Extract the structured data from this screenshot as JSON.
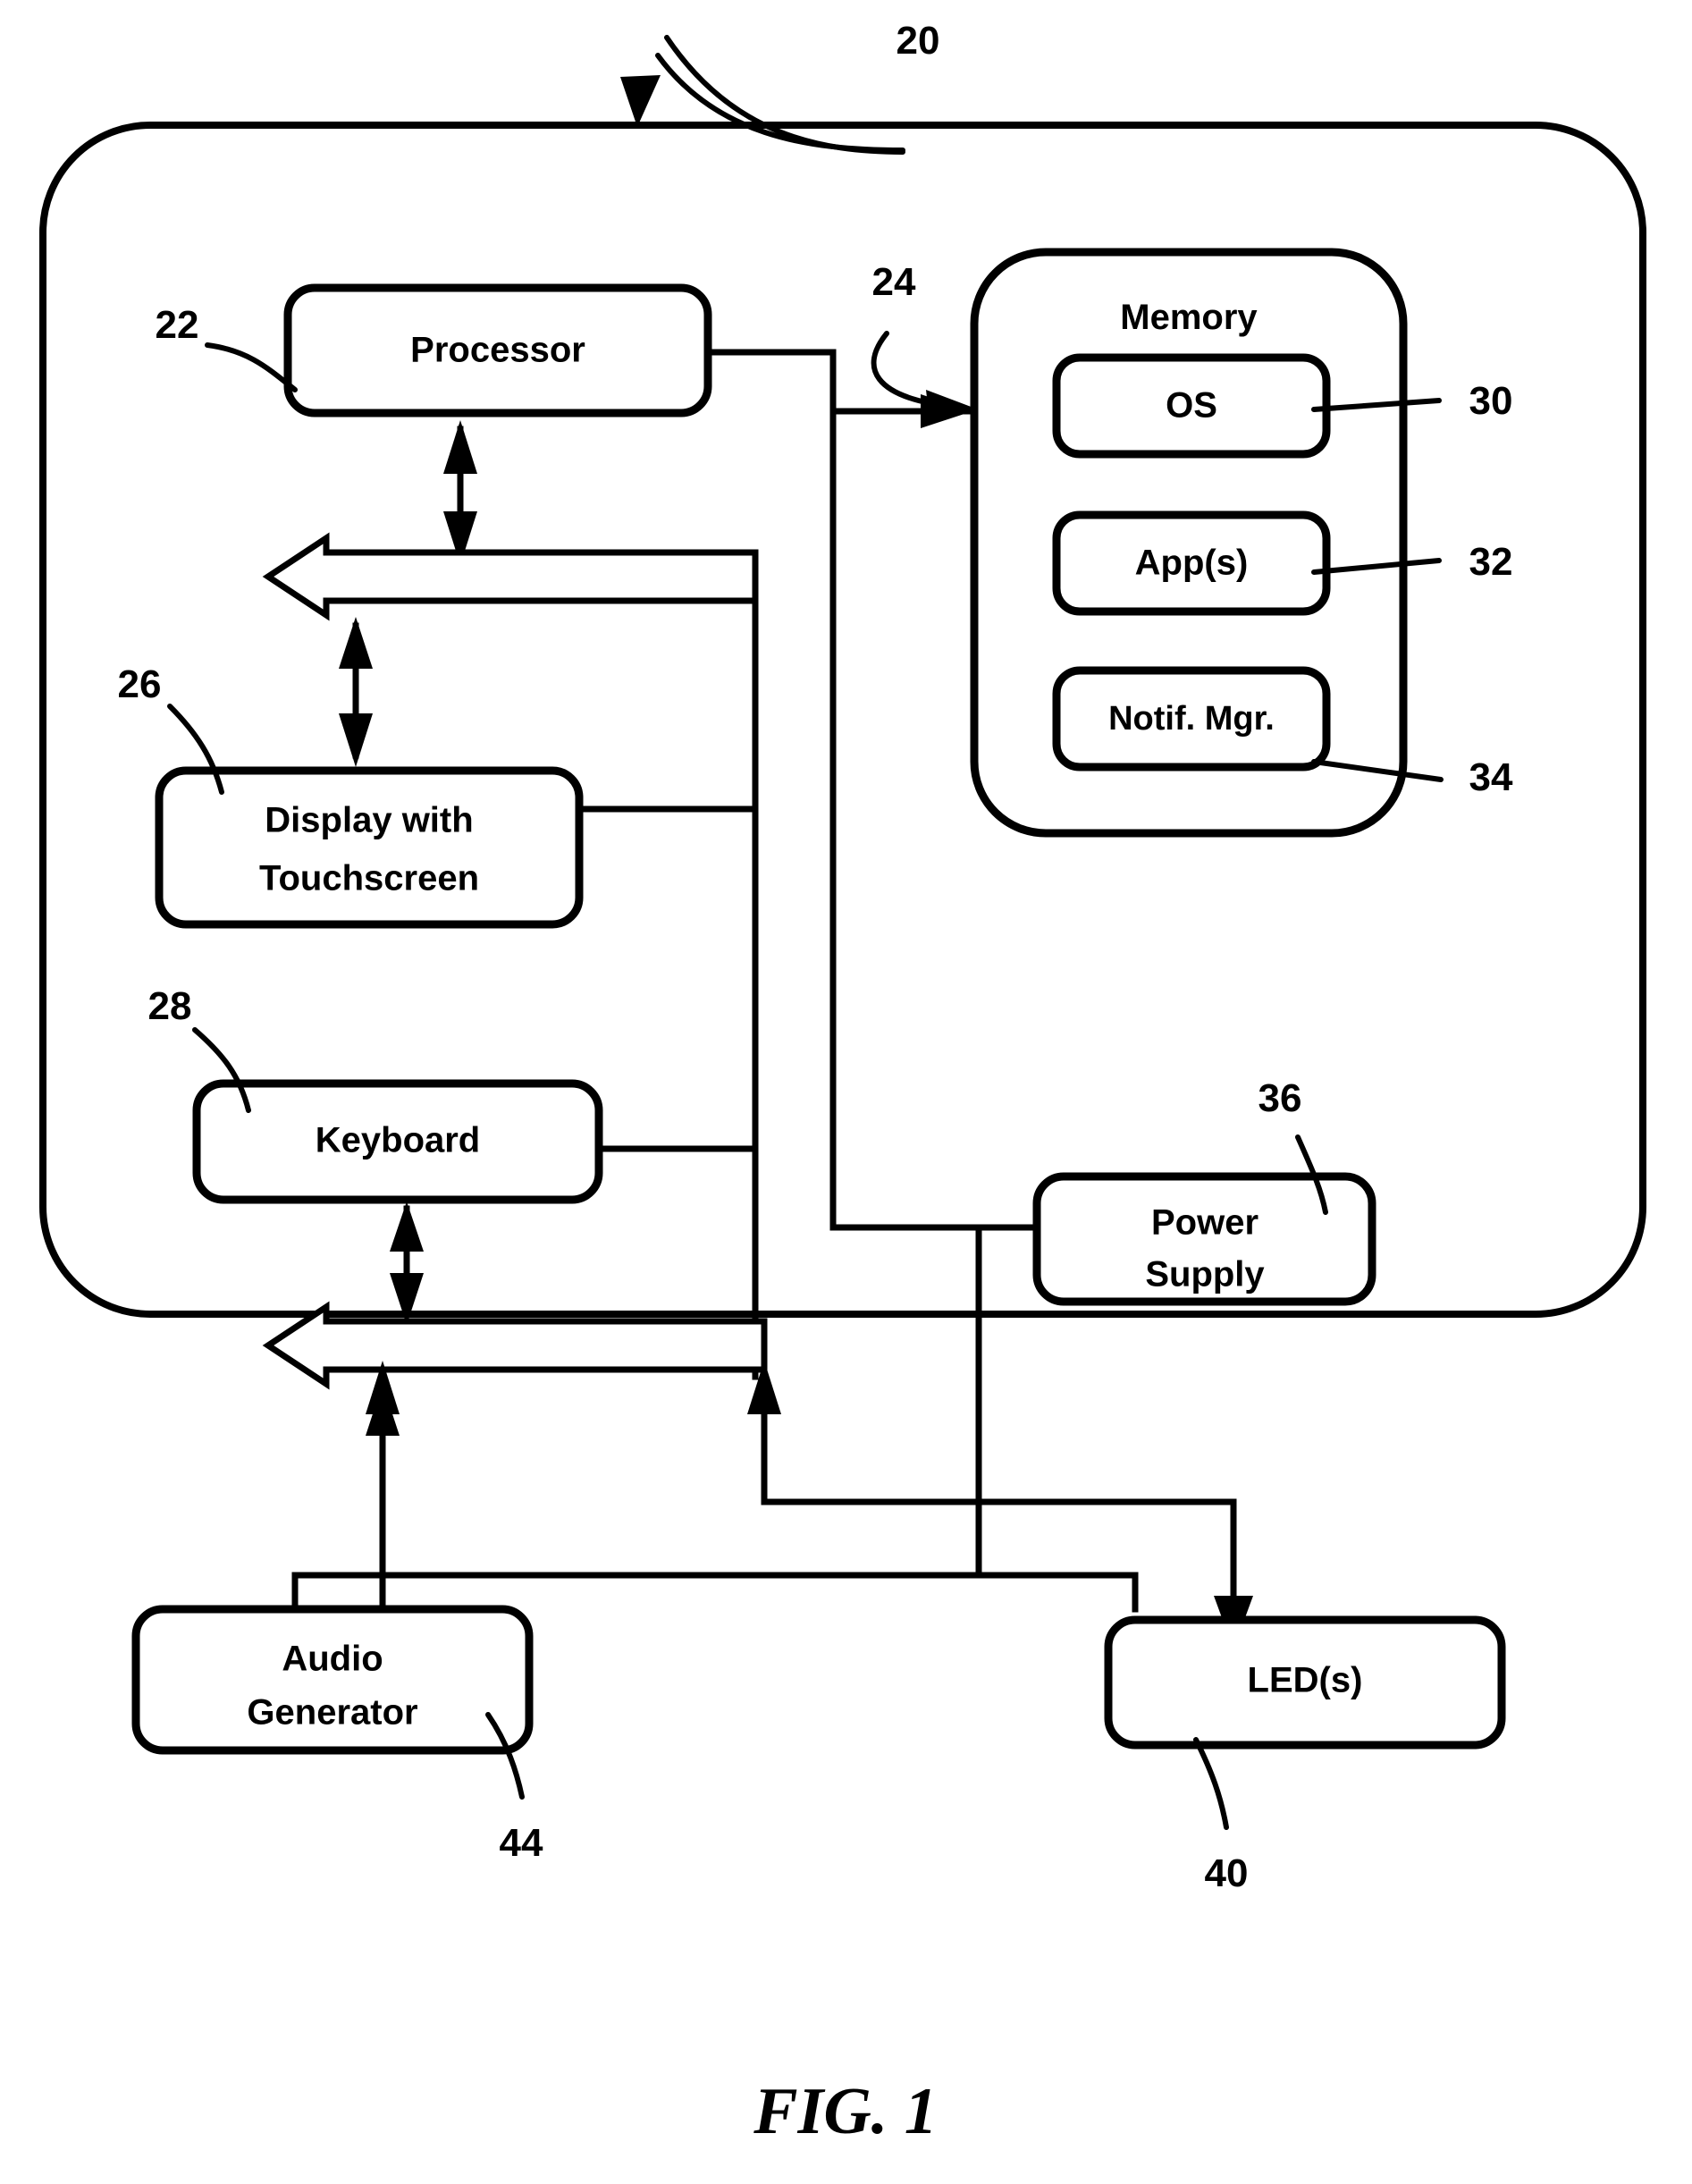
{
  "figure": {
    "caption": "FIG. 1",
    "device_ref": "20"
  },
  "blocks": {
    "processor": {
      "label": "Processor",
      "ref": "22"
    },
    "memory": {
      "label": "Memory",
      "ref": "24",
      "items": [
        {
          "label": "OS",
          "ref": "30"
        },
        {
          "label": "App(s)",
          "ref": "32"
        },
        {
          "label": "Notif. Mgr.",
          "ref": "34"
        }
      ]
    },
    "display": {
      "label_line1": "Display with",
      "label_line2": "Touchscreen",
      "ref": "26"
    },
    "keyboard": {
      "label": "Keyboard",
      "ref": "28"
    },
    "power_supply": {
      "label_line1": "Power",
      "label_line2": "Supply",
      "ref": "36"
    },
    "audio_generator": {
      "label_line1": "Audio",
      "label_line2": "Generator",
      "ref": "44"
    },
    "leds": {
      "label": "LED(s)",
      "ref": "40"
    }
  },
  "colors": {
    "ink": "#000000",
    "paper": "#ffffff"
  }
}
